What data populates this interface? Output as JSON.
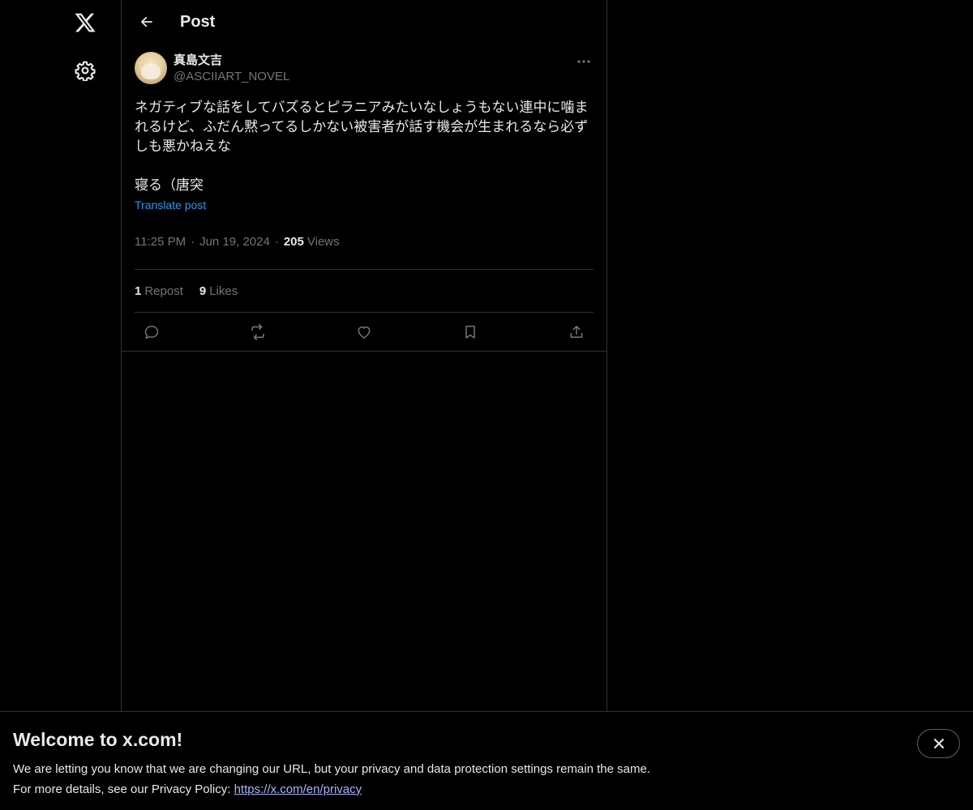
{
  "nav": {
    "logo_icon": "x-logo-icon",
    "settings_icon": "gear-icon"
  },
  "header": {
    "title": "Post",
    "back_icon": "arrow-left-icon"
  },
  "post": {
    "author_name": "真島文吉",
    "author_handle": "@ASCIIART_NOVEL",
    "text": "ネガティブな話をしてバズるとピラニアみたいなしょうもない連中に噛まれるけど、ふだん黙ってるしかない被害者が話す機会が生まれるなら必ずしも悪かねえな\n\n寝る（唐突",
    "translate_label": "Translate post",
    "time": "11:25 PM",
    "date": "Jun 19, 2024",
    "separator": "·",
    "views_count": "205",
    "views_label": "Views",
    "reposts_count": "1",
    "reposts_label": "Repost",
    "likes_count": "9",
    "likes_label": "Likes"
  },
  "actions": [
    "reply-icon",
    "repost-icon",
    "like-icon",
    "bookmark-icon",
    "share-icon"
  ],
  "banner": {
    "title": "Welcome to x.com!",
    "line1": "We are letting you know that we are changing our URL, but your privacy and data protection settings remain the same.",
    "line2_prefix": "For more details, see our Privacy Policy: ",
    "link": "https://x.com/en/privacy"
  },
  "colors": {
    "background": "#000000",
    "text": "#e7e9ea",
    "muted": "#71767b",
    "accent": "#1d9bf0",
    "border": "#2f3336"
  }
}
